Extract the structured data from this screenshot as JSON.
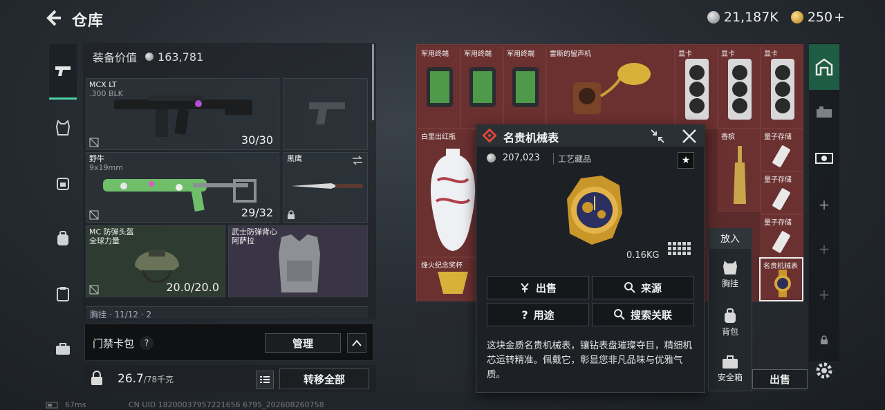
{
  "header": {
    "title": "仓库",
    "currency": [
      {
        "icon": "silver-coin-icon",
        "value": "21,187K"
      },
      {
        "icon": "gold-coin-icon",
        "value": "250"
      }
    ],
    "add_symbol": "+"
  },
  "left_rail": [
    "pistol-icon",
    "armor-icon",
    "chest-rig-icon",
    "backpack-icon",
    "clipboard-icon",
    "briefcase-icon"
  ],
  "loadout": {
    "value_label": "装备价值",
    "value": "163,781",
    "primary": {
      "name": "MCX LT",
      "ammo": ".300 BLK",
      "count": "30/30"
    },
    "secondary": {
      "name": "野牛",
      "ammo": "9x19mm",
      "count": "29/32"
    },
    "melee": {
      "name": "黑鹰"
    },
    "helmet": {
      "name": "MC 防弹头盔",
      "sub": "全球力量",
      "count": "20.0/20.0"
    },
    "vest": {
      "name": "武士防弹背心",
      "sub": "阿萨拉"
    },
    "chest_partial": "胸挂 · 11/12 · 2"
  },
  "card_pack": {
    "label": "门禁卡包",
    "help": "?",
    "manage": "管理"
  },
  "bottom": {
    "weight": "26.7",
    "weight_max": "/78千克",
    "transfer": "转移全部"
  },
  "footer": {
    "ping": "67ms",
    "uid": "CN UID 18200037957221656 6795_202608260758"
  },
  "stash": {
    "cells": [
      {
        "label": "军用终端"
      },
      {
        "label": "军用终端"
      },
      {
        "label": "军用终端"
      },
      {
        "label": "雷斯的留声机"
      },
      {
        "label": "显卡"
      },
      {
        "label": "显卡"
      },
      {
        "label": "显卡"
      },
      {
        "label": "白里出红瓶"
      },
      {
        "label": "香槟"
      },
      {
        "label": "量子存储"
      },
      {
        "label": "量子存储"
      },
      {
        "label": "量子存储"
      },
      {
        "label": "烽火纪念奖杯"
      },
      {
        "label": "名贵机械表"
      }
    ],
    "sell": "出售"
  },
  "popup": {
    "title": "名贵机械表",
    "value": "207,023",
    "category": "工艺藏品",
    "weight": "0.16KG",
    "buttons": {
      "sell": "出售",
      "source": "来源",
      "usage": "用途",
      "search": "搜索关联"
    },
    "description": "这块金质名贵机械表，镶钻表盘璀璨夺目，精细机芯运转精准。佩戴它，彰显您非凡品味与优雅气质。"
  },
  "put_menu": {
    "title": "放入",
    "items": [
      {
        "icon": "chest-rig-icon",
        "label": "胸挂"
      },
      {
        "icon": "backpack-icon",
        "label": "背包"
      },
      {
        "icon": "safe-box-icon",
        "label": "安全箱"
      }
    ]
  },
  "colors": {
    "accent": "#4fd1a5",
    "stash_bg": "#6b3030",
    "gold": "#d9a63a"
  }
}
